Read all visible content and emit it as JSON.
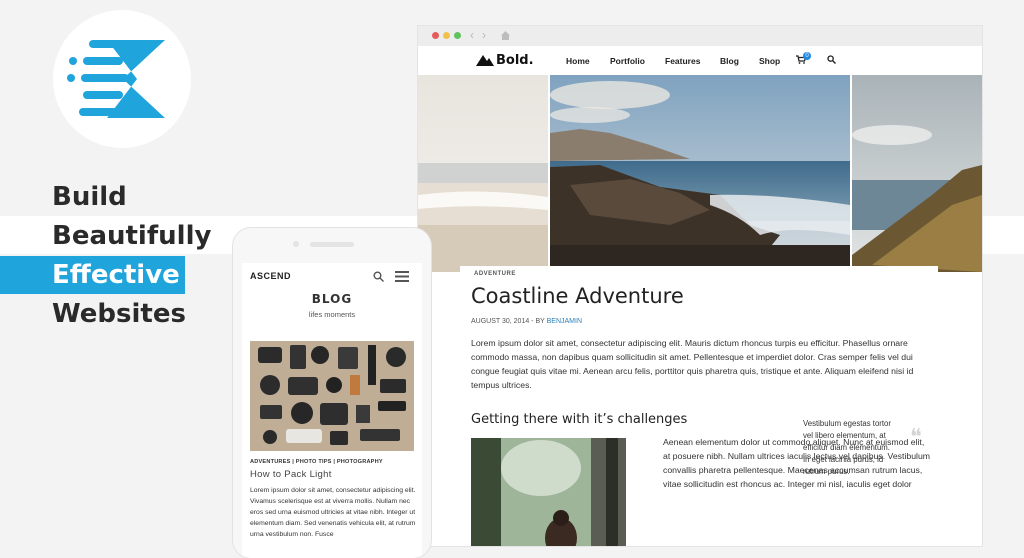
{
  "headline": [
    "Build",
    "Beautifully",
    "Effective",
    "Websites"
  ],
  "colors": {
    "accent": "#1fa4dc",
    "link": "#2a7fba",
    "cart_badge": "#1e88e5"
  },
  "browser": {
    "brand": "Bold.",
    "nav": [
      "Home",
      "Portfolio",
      "Features",
      "Blog",
      "Shop"
    ],
    "cart_count": "0",
    "icons": [
      "cart-icon",
      "search-icon"
    ],
    "post": {
      "category": "ADVENTURE",
      "title": "Coastline Adventure",
      "date": "AUGUST 30, 2014 - BY",
      "author": "BENJAMIN",
      "intro": "Lorem ipsum dolor sit amet, consectetur adipiscing elit. Mauris dictum rhoncus turpis eu efficitur. Phasellus ornare commodo massa, non dapibus quam sollicitudin sit amet. Pellentesque et imperdiet dolor. Cras semper felis vel dui congue feugiat quis vitae mi. Aenean arcu felis, porttitor quis pharetra quis, tristique et ante. Aliquam eleifend nisi id tempus ultrices.",
      "subheading": "Getting there with it’s challenges",
      "body2": "Aenean elementum dolor ut commodo aliquet. Nunc at euismod elit, at posuere nibh. Nullam ultrices iaculis lectus vel dapibus. Vestibulum convallis pharetra pellentesque. Maecenas accumsan rutrum lacus, vitae sollicitudin est rhoncus ac. Integer mi nisl, iaculis eget dolor",
      "pullquote": "Vestibulum egestas tortor vel libero elementum, at efficitur diam elementum. In eget lacinia purus, id rutrum purus."
    }
  },
  "phone": {
    "brand": "ASCEND",
    "title": "BLOG",
    "subtitle": "lifes moments",
    "categories": "ADVENTURES | PHOTO TIPS | PHOTOGRAPHY",
    "post_title": "How to Pack Light",
    "post_body": "Lorem ipsum dolor sit amet, consectetur adipiscing elit. Vivamus scelerisque est at viverra mollis. Nullam nec eros sed urna euismod ultricies at vitae nibh. Integer ut elementum diam. Sed venenatis vehicula elit, at rutrum urna vestibulum non. Fusce"
  }
}
